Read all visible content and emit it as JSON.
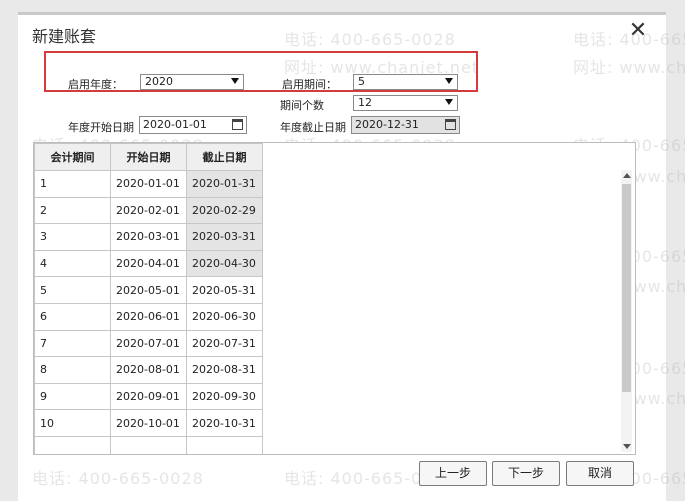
{
  "dialog": {
    "title": "新建账套",
    "close_glyph": "✕"
  },
  "watermark": {
    "phone": "电话: 400-665-0028",
    "site": "网址: www.chanjet.net"
  },
  "form": {
    "start_year_label": "启用年度：",
    "start_year_value": "2020",
    "start_period_label": "启用期间：",
    "start_period_value": "5",
    "period_count_label": "期间个数",
    "period_count_value": "12",
    "fy_start_label": "年度开始日期",
    "fy_start_value": "2020-01-01",
    "fy_end_label": "年度截止日期",
    "fy_end_value": "2020-12-31"
  },
  "table": {
    "headers": [
      "会计期间",
      "开始日期",
      "截止日期"
    ],
    "rows": [
      [
        "1",
        "2020-01-01",
        "2020-01-31"
      ],
      [
        "2",
        "2020-02-01",
        "2020-02-29"
      ],
      [
        "3",
        "2020-03-01",
        "2020-03-31"
      ],
      [
        "4",
        "2020-04-01",
        "2020-04-30"
      ],
      [
        "5",
        "2020-05-01",
        "2020-05-31"
      ],
      [
        "6",
        "2020-06-01",
        "2020-06-30"
      ],
      [
        "7",
        "2020-07-01",
        "2020-07-31"
      ],
      [
        "8",
        "2020-08-01",
        "2020-08-31"
      ],
      [
        "9",
        "2020-09-01",
        "2020-09-30"
      ],
      [
        "10",
        "2020-10-01",
        "2020-10-31"
      ]
    ]
  },
  "buttons": {
    "prev": "上一步",
    "next": "下一步",
    "cancel": "取消"
  },
  "colors": {
    "highlight_box": "#d43c3c",
    "readonly_cell": "#e4e4e4"
  }
}
